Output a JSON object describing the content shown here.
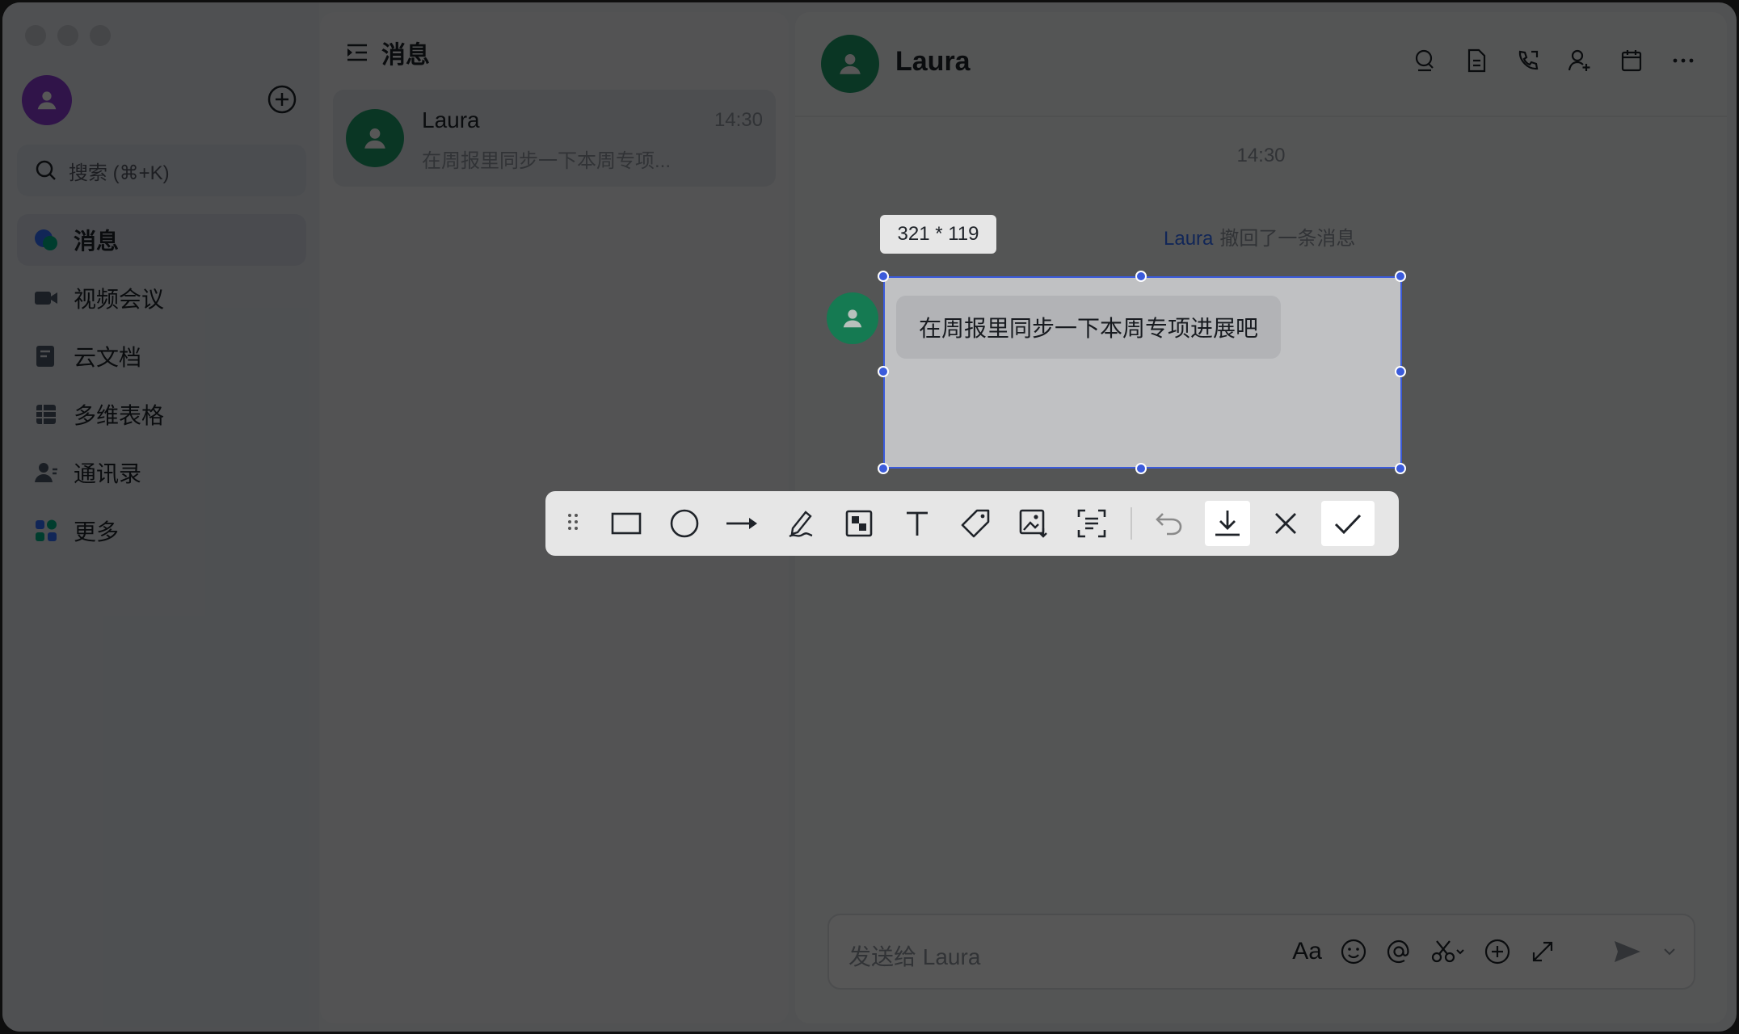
{
  "sidebar": {
    "search_placeholder": "搜索 (⌘+K)",
    "nav": [
      {
        "label": "消息",
        "icon": "messages-icon"
      },
      {
        "label": "视频会议",
        "icon": "video-meeting-icon"
      },
      {
        "label": "云文档",
        "icon": "cloud-docs-icon"
      },
      {
        "label": "多维表格",
        "icon": "bitable-icon"
      },
      {
        "label": "通讯录",
        "icon": "contacts-icon"
      },
      {
        "label": "更多",
        "icon": "more-apps-icon"
      }
    ]
  },
  "conversations": {
    "title": "消息",
    "items": [
      {
        "name": "Laura",
        "time": "14:30",
        "preview": "在周报里同步一下本周专项..."
      }
    ]
  },
  "chat": {
    "title": "Laura",
    "time_separator": "14:30",
    "recall_actor": "Laura",
    "recall_text": "撤回了一条消息",
    "message": "在周报里同步一下本周专项进展吧",
    "input_placeholder": "发送给 Laura",
    "input_tool_format_label": "Aa"
  },
  "screenshot": {
    "size_label": "321 * 119",
    "selection": {
      "width": 321,
      "height": 119
    },
    "tools": [
      "rectangle-icon",
      "ellipse-icon",
      "arrow-icon",
      "pen-icon",
      "mosaic-icon",
      "text-icon",
      "tag-icon",
      "pin-image-icon",
      "ocr-icon"
    ],
    "actions": [
      "undo-icon",
      "download-icon",
      "close-icon",
      "confirm-icon"
    ]
  },
  "colors": {
    "accent": "#3370ff",
    "selection_border": "#3b5bdb",
    "avatar_green": "#1e9e6a",
    "avatar_purple": "#8c3bd6"
  }
}
